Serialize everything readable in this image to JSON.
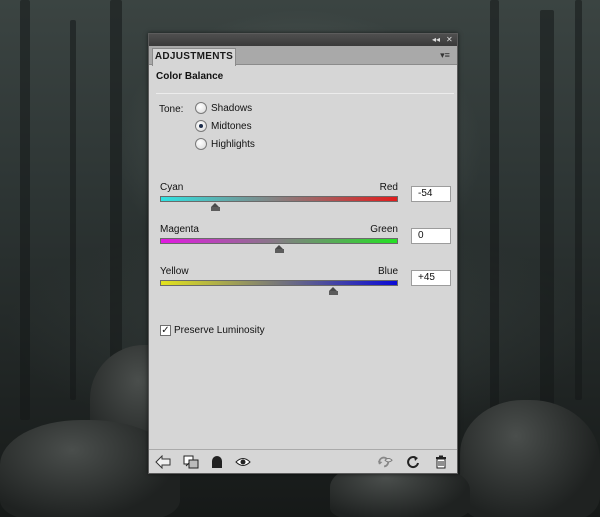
{
  "panel": {
    "tab_label": "ADJUSTMENTS",
    "heading": "Color Balance",
    "collapse_glyph": "◂◂",
    "close_glyph": "✕",
    "menu_glyph": "▾≡"
  },
  "tone": {
    "label": "Tone:",
    "options": [
      {
        "label": "Shadows",
        "selected": false
      },
      {
        "label": "Midtones",
        "selected": true
      },
      {
        "label": "Highlights",
        "selected": false
      }
    ]
  },
  "sliders": [
    {
      "left_label": "Cyan",
      "right_label": "Red",
      "value": "-54",
      "numeric": -54
    },
    {
      "left_label": "Magenta",
      "right_label": "Green",
      "value": "0",
      "numeric": 0
    },
    {
      "left_label": "Yellow",
      "right_label": "Blue",
      "value": "+45",
      "numeric": 45
    }
  ],
  "preserve_luminosity": {
    "label": "Preserve Luminosity",
    "checked": true,
    "check_glyph": "✓"
  },
  "bottom_icons": [
    "return-arrow-icon",
    "clip-to-layer-icon",
    "layer-visibility-mask-icon",
    "eye-icon",
    "view-previous-state-icon",
    "reset-icon",
    "trash-icon"
  ]
}
